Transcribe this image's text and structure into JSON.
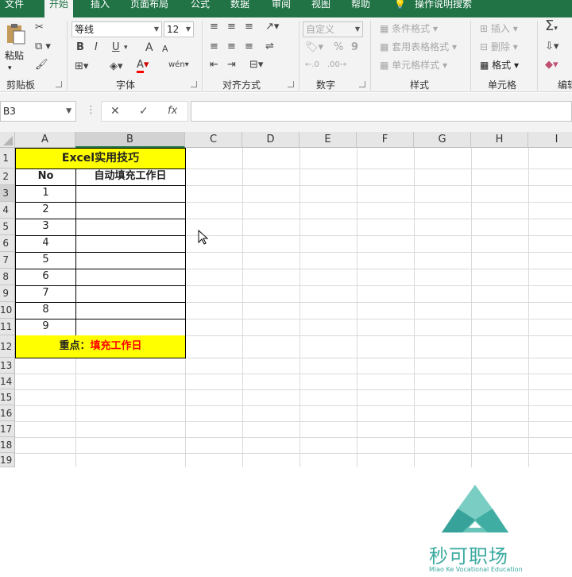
{
  "ribbon_tabs": [
    "文件",
    "开始",
    "插入",
    "页面布局",
    "公式",
    "数据",
    "审阅",
    "视图",
    "帮助",
    "操作说明搜索"
  ],
  "active_tab": "开始",
  "clipboard": {
    "paste_label": "粘贴",
    "group_label": "剪贴板"
  },
  "font": {
    "name": "等线",
    "size": "12",
    "bold": "B",
    "italic": "I",
    "underline": "U",
    "grow": "A",
    "shrink": "A",
    "group_label": "字体"
  },
  "alignment": {
    "group_label": "对齐方式"
  },
  "number": {
    "format": "自定义",
    "percent": "%",
    "comma": "9",
    "group_label": "数字"
  },
  "styles": {
    "conditional": "条件格式",
    "table": "套用表格格式",
    "cell": "单元格样式",
    "group_label": "样式"
  },
  "cells": {
    "insert": "插入",
    "delete": "删除",
    "format": "格式",
    "group_label": "单元格"
  },
  "editing": {
    "sum": "Σ",
    "group_label": "编辑"
  },
  "formula_bar": {
    "name_box": "B3",
    "fx": "fx",
    "cancel": "✕",
    "confirm": "✓",
    "formula": ""
  },
  "columns": [
    "A",
    "B",
    "C",
    "D",
    "E",
    "F",
    "G",
    "H",
    "I"
  ],
  "rows": [
    "1",
    "2",
    "3",
    "4",
    "5",
    "6",
    "7",
    "8",
    "9",
    "10",
    "11",
    "12",
    "13",
    "14",
    "15",
    "16",
    "17",
    "18",
    "19"
  ],
  "sheet": {
    "title": "Excel实用技巧",
    "header_no": "No",
    "header_b": "自动填充工作日",
    "numbers": [
      "1",
      "2",
      "3",
      "4",
      "5",
      "6",
      "7",
      "8",
      "9"
    ],
    "note_prefix": "重点：",
    "note_text": "填充工作日"
  },
  "watermark": {
    "brand": "秒可职场",
    "sub": "Miao Ke Vocational Education"
  },
  "colors": {
    "excel_green": "#217346",
    "highlight": "#ffff00",
    "note_red": "#ff0000"
  }
}
